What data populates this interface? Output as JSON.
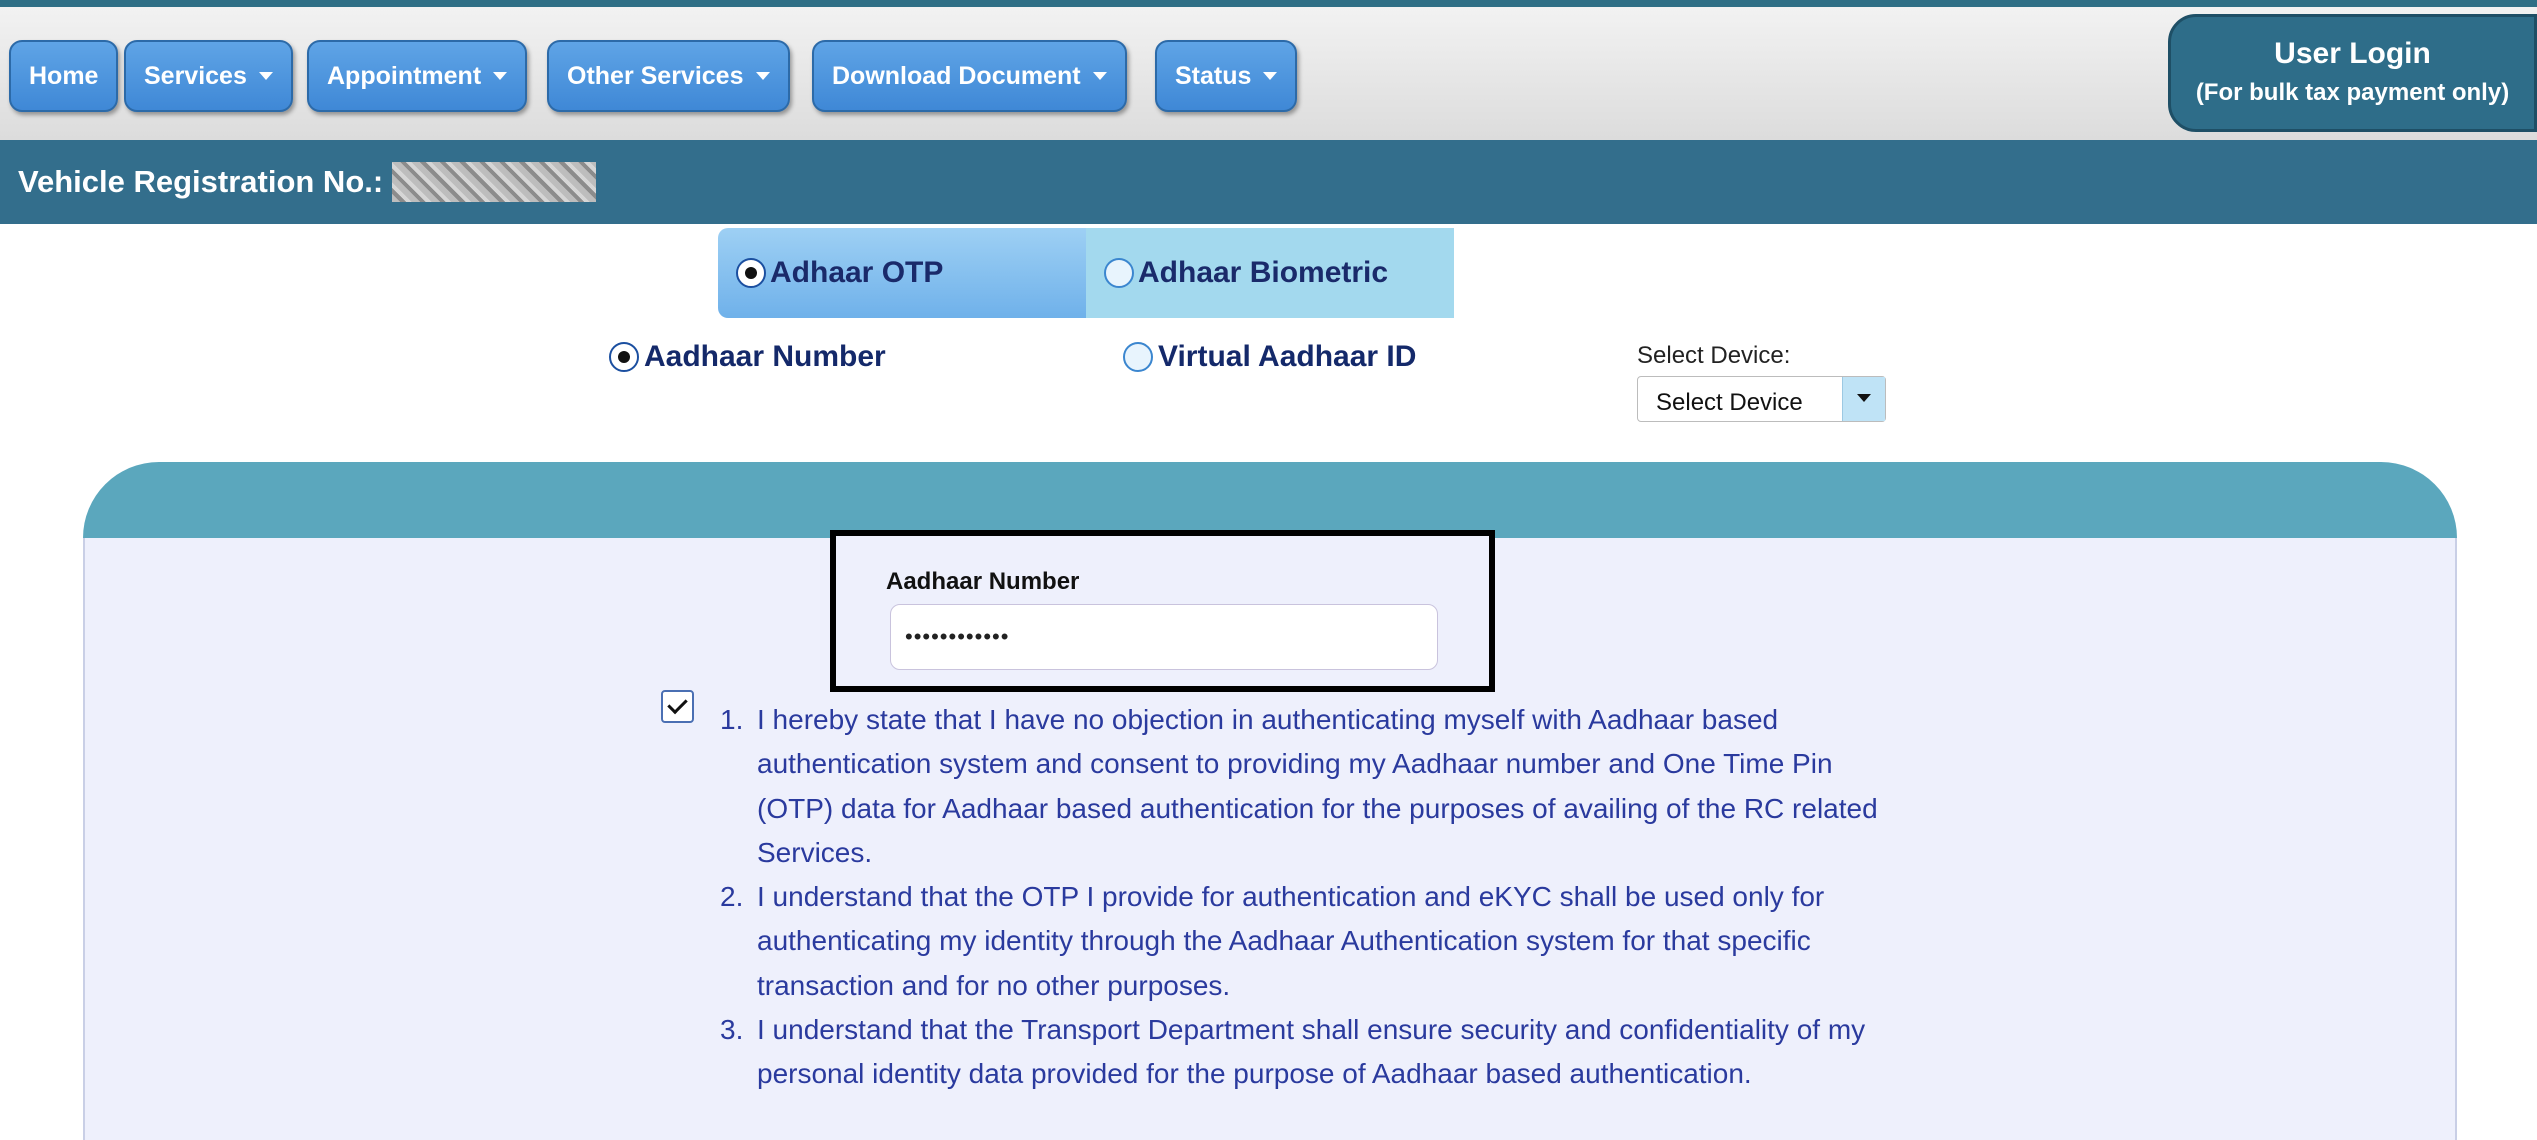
{
  "nav": {
    "home": "Home",
    "services": "Services",
    "appointment": "Appointment",
    "other_services": "Other Services",
    "download_document": "Download Document",
    "status": "Status"
  },
  "user_login": {
    "title": "User Login",
    "subtitle": "(For bulk tax payment only)"
  },
  "vehicle": {
    "label": "Vehicle Registration No.:"
  },
  "auth_tabs": {
    "otp": "Adhaar OTP",
    "otp_selected": true,
    "biometric": "Adhaar Biometric"
  },
  "id_type": {
    "aadhaar_number": "Aadhaar Number",
    "aadhaar_number_selected": true,
    "virtual_id": "Virtual Aadhaar ID"
  },
  "device": {
    "label": "Select Device:",
    "selected": "Select Device"
  },
  "form": {
    "aadhaar_label": "Aadhaar Number",
    "aadhaar_value": "••••••••••••"
  },
  "consent": {
    "checked": true,
    "items": [
      {
        "num": "1.",
        "text": "I hereby state that I have no objection in authenticating myself with Aadhaar based authentication system and consent to providing my Aadhaar number and One Time Pin (OTP) data for Aadhaar based authentication for the purposes of availing of the RC related Services."
      },
      {
        "num": "2.",
        "text": "I understand that the OTP I provide for authentication and eKYC shall be used only for authenticating my identity through the Aadhaar Authentication system for that specific transaction and for no other purposes."
      },
      {
        "num": "3.",
        "text": "I understand that the Transport Department shall ensure security and confidentiality of my personal identity data provided for the purpose of Aadhaar based authentication."
      }
    ]
  },
  "colors": {
    "nav_button": "#4a93dc",
    "header_bar": "#336e8c",
    "panel_head": "#5ba7bd",
    "panel_body": "#eef0fc",
    "consent_text": "#2a3a9e"
  },
  "icons": {
    "dropdown_caret": "caret-down-icon",
    "checkbox": "checkmark-icon"
  }
}
